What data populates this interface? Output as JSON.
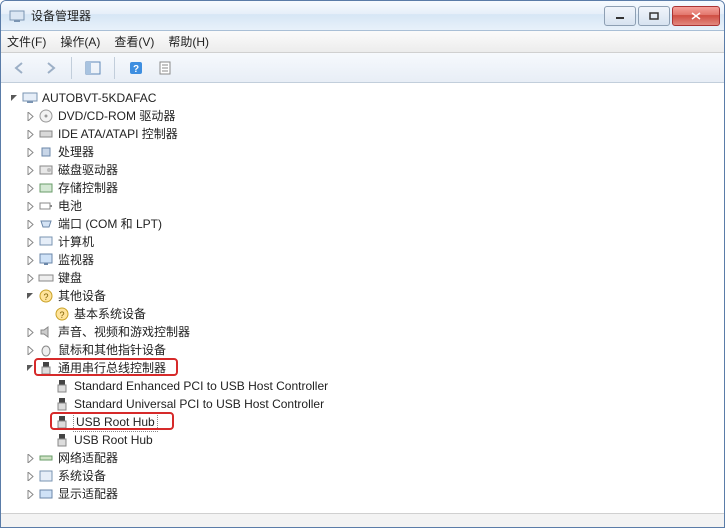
{
  "window": {
    "title": "设备管理器"
  },
  "menu": {
    "file": "文件(F)",
    "action": "操作(A)",
    "view": "查看(V)",
    "help": "帮助(H)"
  },
  "tree": {
    "root": "AUTOBVT-5KDAFAC",
    "items": {
      "dvd": "DVD/CD-ROM 驱动器",
      "ide": "IDE ATA/ATAPI 控制器",
      "cpu": "处理器",
      "disk": "磁盘驱动器",
      "storage": "存储控制器",
      "battery": "电池",
      "ports": "端口 (COM 和 LPT)",
      "computer": "计算机",
      "monitor": "监视器",
      "keyboard": "键盘",
      "other": "其他设备",
      "other_child": "基本系统设备",
      "sound": "声音、视频和游戏控制器",
      "mouse": "鼠标和其他指针设备",
      "usb": "通用串行总线控制器",
      "usb1": "Standard Enhanced PCI to USB Host Controller",
      "usb2": "Standard Universal PCI to USB Host Controller",
      "usb3": "USB Root Hub",
      "usb4": "USB Root Hub",
      "network": "网络适配器",
      "system": "系统设备",
      "display": "显示适配器"
    }
  }
}
